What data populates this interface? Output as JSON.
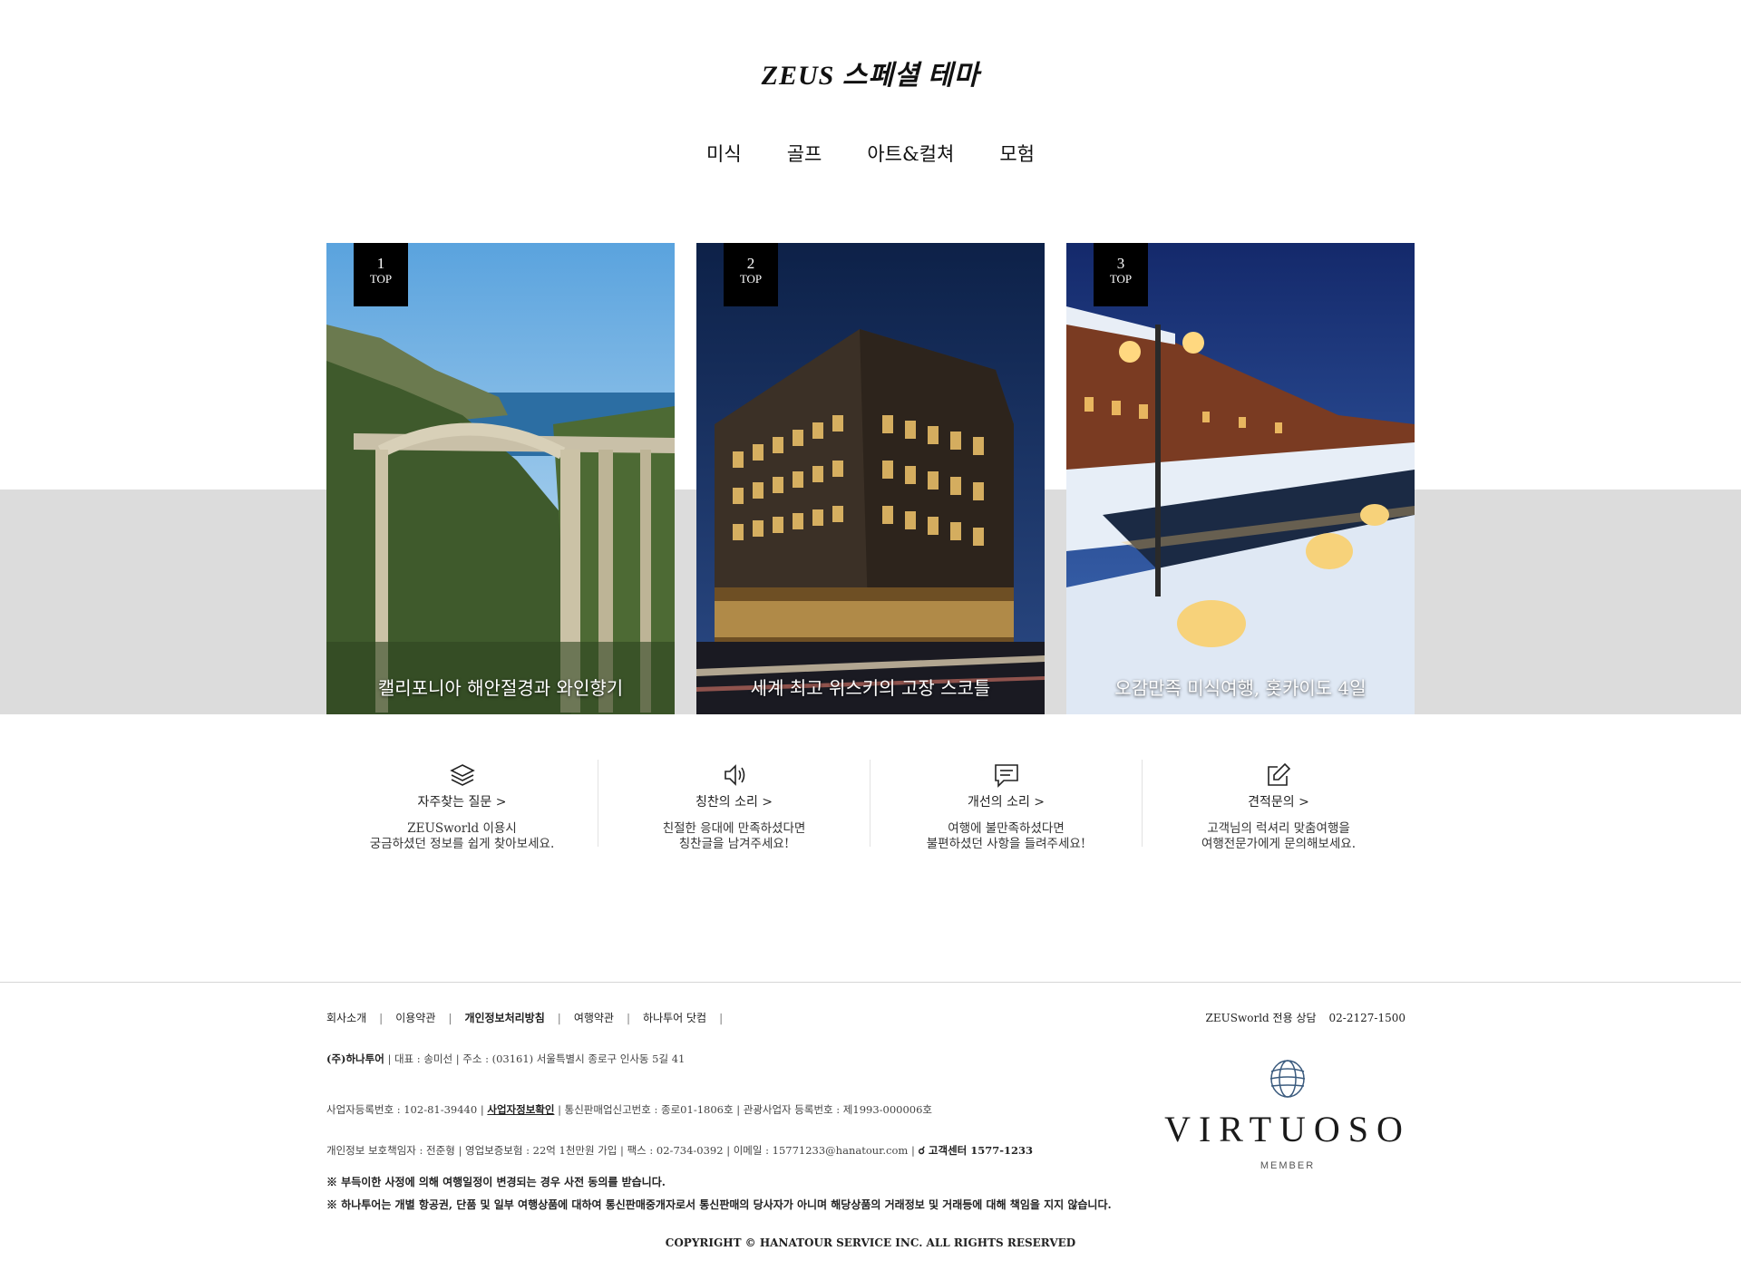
{
  "header": {
    "title": "ZEUS 스페셜 테마",
    "tabs": [
      "미식",
      "골프",
      "아트&컬쳐",
      "모험"
    ]
  },
  "cards": [
    {
      "rank": "1",
      "rank_label": "TOP",
      "caption": "캘리포니아 해안절경과 와인향기"
    },
    {
      "rank": "2",
      "rank_label": "TOP",
      "caption": "세계 최고 위스키의 고장 스코틀"
    },
    {
      "rank": "3",
      "rank_label": "TOP",
      "caption": "오감만족 미식여행, 홋카이도 4일"
    }
  ],
  "services": [
    {
      "icon": "layers-icon",
      "title": "자주찾는 질문 >",
      "desc": "ZEUSworld 이용시\n궁금하셨던 정보를 쉽게 찾아보세요."
    },
    {
      "icon": "speaker-icon",
      "title": "칭찬의 소리 >",
      "desc": "친절한 응대에 만족하셨다면\n칭찬글을 남겨주세요!"
    },
    {
      "icon": "message-icon",
      "title": "개선의 소리 >",
      "desc": "여행에 불만족하셨다면\n불편하셨던 사항을 들려주세요!"
    },
    {
      "icon": "edit-icon",
      "title": "견적문의 >",
      "desc": "고객님의 럭셔리 맞춤여행을\n여행전문가에게 문의해보세요."
    }
  ],
  "footer": {
    "links": [
      {
        "label": "회사소개",
        "bold": false
      },
      {
        "label": "이용약관",
        "bold": false
      },
      {
        "label": "개인정보처리방침",
        "bold": true
      },
      {
        "label": "여행약관",
        "bold": false
      },
      {
        "label": "하나투어 닷컴",
        "bold": false
      }
    ],
    "hotline_label": "ZEUSworld 전용 상담",
    "hotline_number": "02-2127-1500",
    "company_name": "(주)하나투어",
    "company_rest": " | 대표 : 송미선 | 주소 : (03161) 서울특별시 종로구 인사동 5길 41",
    "biz_reg": "사업자등록번호 : 102-81-39440 | ",
    "biz_check": "사업자정보확인",
    "biz_rest": " | 통신판매업신고번호 : 종로01-1806호 | 관광사업자 등록번호 : 제1993-000006호",
    "privacy": "개인정보 보호책임자 : 전준형 | 영업보증보험 : 22억 1천만원 가입 | 팩스 : 02-734-0392 | 이메일 : 15771233@hanatour.com | ",
    "call_center": "고객센터 1577-1233",
    "notice1": "※ 부득이한 사정에 의해 여행일정이 변경되는 경우 사전 동의를 받습니다.",
    "notice2": "※ 하나투어는 개별 항공권, 단품 및 일부 여행상품에 대하여 통신판매중개자로서 통신판매의 당사자가 아니며 해당상품의 거래정보 및 거래등에 대해 책임을 지지 않습니다.",
    "copyright": "COPYRIGHT © HANATOUR SERVICE INC. ALL RIGHTS RESERVED",
    "partner_name": "VIRTUOSO",
    "partner_sub": "MEMBER"
  }
}
